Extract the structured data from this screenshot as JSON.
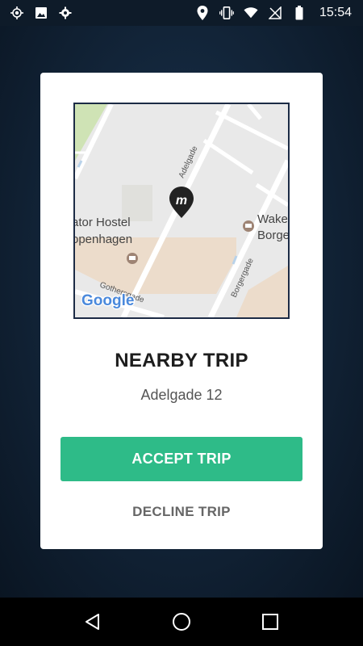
{
  "status_bar": {
    "time": "15:54",
    "left_icons": [
      "location-target-icon",
      "image-icon",
      "settings-icon"
    ],
    "right_icons": [
      "location-pin-icon",
      "vibrate-icon",
      "wifi-icon",
      "no-signal-icon",
      "battery-icon"
    ]
  },
  "map": {
    "labels": {
      "hostel_line1": "ator Hostel",
      "hostel_line2": "openhagen",
      "street_adelgade": "Adelgade",
      "street_borgergade": "Borgergade",
      "street_gothersgade": "Gothersgade",
      "poi_wake_line1": "Wake",
      "poi_wake_line2": "Borge",
      "google_logo": "Google"
    },
    "marker_letter": "m"
  },
  "trip": {
    "title": "NEARBY TRIP",
    "address": "Adelgade 12"
  },
  "actions": {
    "accept_label": "ACCEPT TRIP",
    "decline_label": "DECLINE TRIP"
  },
  "colors": {
    "accent": "#2ebb88",
    "background": "#13263b"
  }
}
